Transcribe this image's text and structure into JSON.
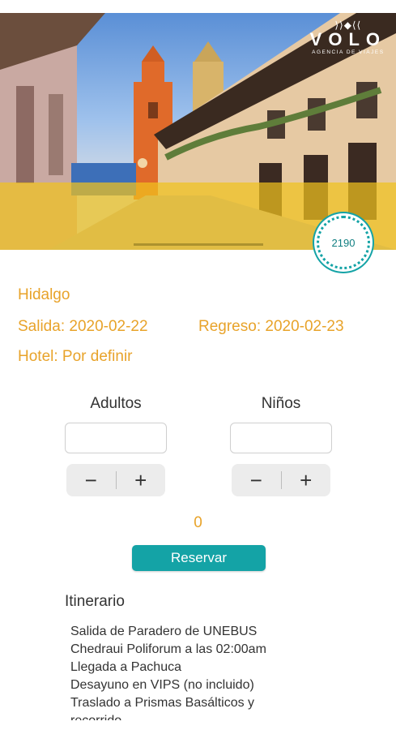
{
  "header": {
    "logo_name": "VOLO",
    "logo_tagline": "AGENCIA DE VIAJES",
    "price_badge": "2190"
  },
  "trip": {
    "destination": "Hidalgo",
    "departure": "Salida: 2020-02-22",
    "return": "Regreso: 2020-02-23",
    "hotel": "Hotel: Por definir"
  },
  "counters": {
    "adults_label": "Adultos",
    "children_label": "Niños",
    "adults_value": "",
    "children_value": "",
    "minus": "−",
    "plus": "+"
  },
  "total": "0",
  "reserve_label": "Reservar",
  "itinerary": {
    "title": "Itinerario",
    "lines": [
      "Salida de Paradero de UNEBUS",
      "Chedraui Poliforum a las 02:00am",
      "Llegada a Pachuca",
      "Desayuno en VIPS (no incluido)",
      "Traslado a Prismas Basálticos y",
      "recorrido"
    ]
  },
  "colors": {
    "accent_teal": "#14a3a6",
    "info_orange": "#e8a32a"
  }
}
